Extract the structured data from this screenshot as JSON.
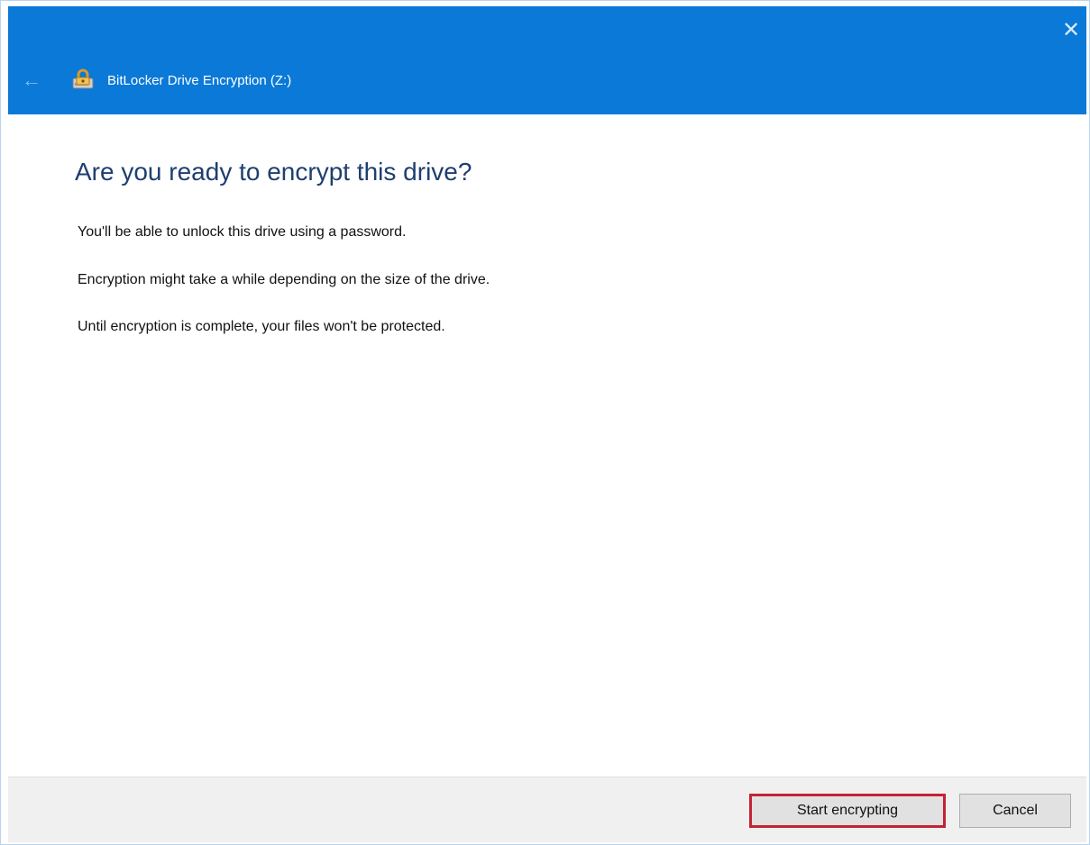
{
  "window": {
    "title": "BitLocker Drive Encryption (Z:)",
    "close_symbol": "✕",
    "back_symbol": "←",
    "accent_color": "#0a79d8",
    "icon": "bitlocker-drive-icon"
  },
  "content": {
    "heading": "Are you ready to encrypt this drive?",
    "paragraphs": [
      "You'll be able to unlock this drive using a password.",
      "Encryption might take a while depending on the size of the drive.",
      "Until encryption is complete, your files won't be protected."
    ]
  },
  "footer": {
    "primary_button": "Start encrypting",
    "cancel_button": "Cancel",
    "highlight_color": "#c42334"
  }
}
